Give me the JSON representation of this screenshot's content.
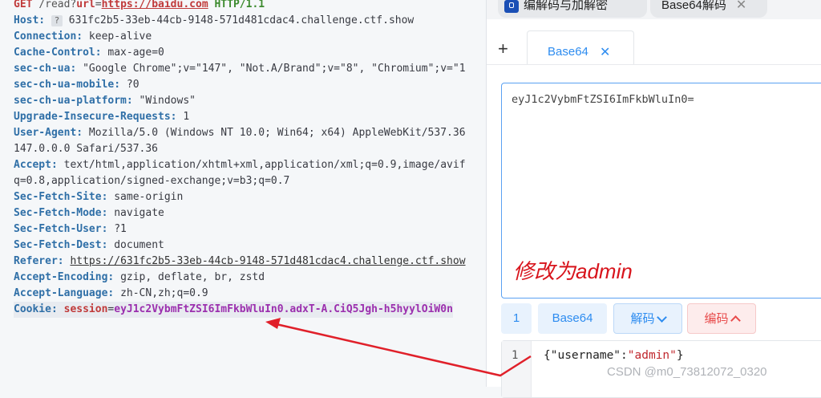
{
  "request": {
    "method": "GET",
    "path_prefix": "/read?",
    "param_name": "url",
    "param_eq": "=",
    "param_value": "https://baidu.com",
    "protocol": "HTTP/1.1",
    "headers": {
      "host_key": "Host:",
      "host_badge": "?",
      "host_val": "631fc2b5-33eb-44cb-9148-571d481cdac4.challenge.ctf.show",
      "connection_key": "Connection:",
      "connection_val": "keep-alive",
      "cache_key": "Cache-Control:",
      "cache_val": "max-age=0",
      "secchua_key": "sec-ch-ua:",
      "secchua_val": "\"Google Chrome\";v=\"147\", \"Not.A/Brand\";v=\"8\", \"Chromium\";v=\"1",
      "mobile_key": "sec-ch-ua-mobile:",
      "mobile_val": "?0",
      "platform_key": "sec-ch-ua-platform:",
      "platform_val": "\"Windows\"",
      "upgrade_key": "Upgrade-Insecure-Requests:",
      "upgrade_val": "1",
      "ua_key": "User-Agent:",
      "ua_val": "Mozilla/5.0 (Windows NT 10.0; Win64; x64) AppleWebKit/537.36",
      "ua_val2": "147.0.0.0 Safari/537.36",
      "accept_key": "Accept:",
      "accept_val": "text/html,application/xhtml+xml,application/xml;q=0.9,image/avif",
      "accept_val2": "q=0.8,application/signed-exchange;v=b3;q=0.7",
      "site_key": "Sec-Fetch-Site:",
      "site_val": "same-origin",
      "mode_key": "Sec-Fetch-Mode:",
      "mode_val": "navigate",
      "user_key": "Sec-Fetch-User:",
      "user_val": "?1",
      "dest_key": "Sec-Fetch-Dest:",
      "dest_val": "document",
      "referer_key": "Referer:",
      "referer_val": "https://631fc2b5-33eb-44cb-9148-571d481cdac4.challenge.ctf.show",
      "encoding_key": "Accept-Encoding:",
      "encoding_val": "gzip, deflate, br, zstd",
      "lang_key": "Accept-Language:",
      "lang_val": "zh-CN,zh;q=0.9",
      "cookie_key": "Cookie:",
      "cookie_name": "session",
      "cookie_eq": "=",
      "cookie_val": "eyJ1c2VybmFtZSI6ImFkbWluIn0.adxT-A.CiQ5Jgh-h5hyylOiW0n"
    }
  },
  "panel": {
    "tab1_label": "编解码与加解密",
    "tab2_label": "Base64解码",
    "tab2_close": "✕",
    "plus": "+",
    "b64_tab_label": "Base64",
    "b64_tab_close": "✕",
    "input_text": "eyJ1c2VybmFtZSI6ImFkbWluIn0=",
    "annotation": "修改为admin",
    "btn_count": "1",
    "btn_base64": "Base64",
    "btn_decode": "解码",
    "btn_encode": "编码",
    "output_line_no": "1",
    "output_open": "{",
    "output_key": "\"username\"",
    "output_colon": ":",
    "output_val": "\"admin\"",
    "output_close": "}"
  },
  "watermark": "CSDN @m0_73812072_0320",
  "colors": {
    "header_key": "#2f6fa7",
    "cookie_value": "#9b2fae",
    "accent_blue": "#2d8cf0",
    "annotation_red": "#d8141c",
    "arrow_red": "#e0202a"
  }
}
